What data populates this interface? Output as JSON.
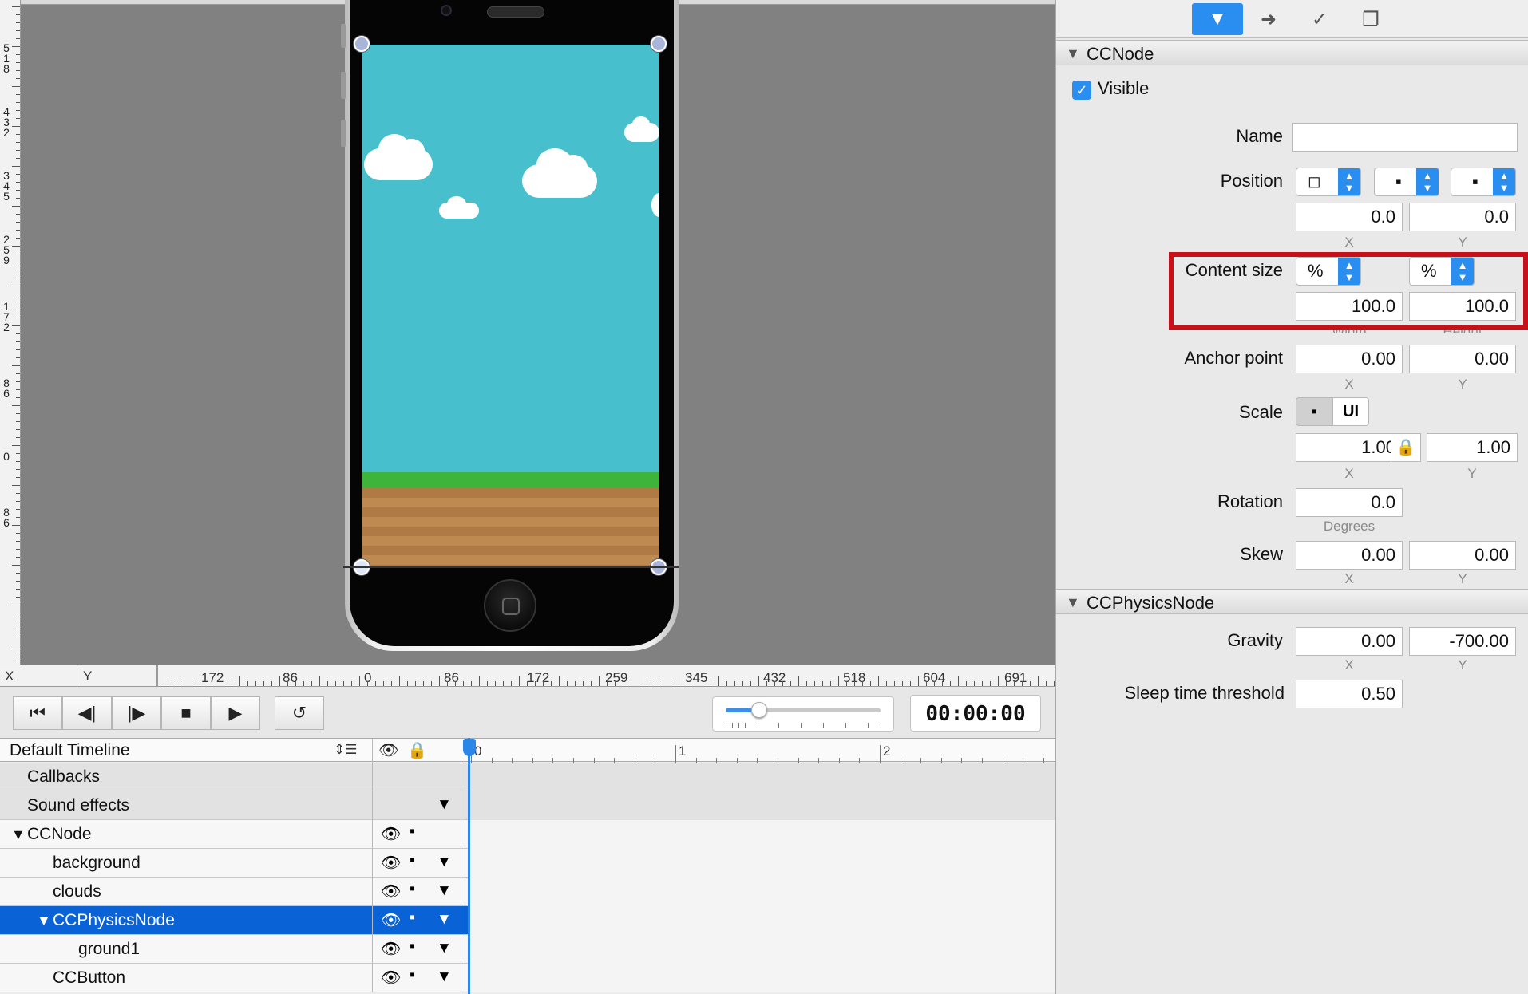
{
  "rulers": {
    "vertical_labels": [
      "518",
      "432",
      "345",
      "259",
      "172",
      "86",
      "0",
      "86"
    ],
    "x_label": "X",
    "y_label": "Y",
    "horizontal_labels": [
      "172",
      "86",
      "0",
      "86",
      "172",
      "259",
      "345",
      "432",
      "518",
      "604",
      "691"
    ]
  },
  "transport": {
    "buttons": [
      "skip-to-start",
      "step-back",
      "step-forward",
      "stop",
      "play",
      "loop"
    ],
    "timecode": "00:00:00"
  },
  "timeline": {
    "name": "Default Timeline",
    "ruler_labels": [
      "0",
      "1",
      "2"
    ],
    "rows": [
      {
        "label": "Callbacks",
        "indent": 0
      },
      {
        "label": "Sound effects",
        "indent": 0
      },
      {
        "label": "CCNode",
        "indent": 0,
        "expanded": true
      },
      {
        "label": "background",
        "indent": 1
      },
      {
        "label": "clouds",
        "indent": 1
      },
      {
        "label": "CCPhysicsNode",
        "indent": 1,
        "expanded": true,
        "selected": true
      },
      {
        "label": "ground1",
        "indent": 2
      },
      {
        "label": "CCButton",
        "indent": 1
      }
    ]
  },
  "inspector": {
    "tabs": [
      "node-properties",
      "code-connections",
      "physics",
      "templates"
    ],
    "ccnode": {
      "section": "CCNode",
      "visible_label": "Visible",
      "visible_checked": true,
      "name_label": "Name",
      "name_value": "",
      "position_label": "Position",
      "position_x": "0.0",
      "position_y": "0.0",
      "x_sub": "X",
      "y_sub": "Y",
      "content_size_label": "Content size",
      "content_unit_w": "%",
      "content_unit_h": "%",
      "content_w": "100.0",
      "content_h": "100.0",
      "width_sub": "Width",
      "height_sub": "Height",
      "anchor_label": "Anchor point",
      "anchor_x": "0.00",
      "anchor_y": "0.00",
      "scale_label": "Scale",
      "scale_ui": "UI",
      "scale_x": "1.00",
      "scale_y": "1.00",
      "rotation_label": "Rotation",
      "rotation": "0.0",
      "degrees_sub": "Degrees",
      "skew_label": "Skew",
      "skew_x": "0.00",
      "skew_y": "0.00"
    },
    "physics": {
      "section": "CCPhysicsNode",
      "gravity_label": "Gravity",
      "gravity_x": "0.00",
      "gravity_y": "-700.00",
      "sleep_label": "Sleep time threshold",
      "sleep_value": "0.50"
    }
  }
}
